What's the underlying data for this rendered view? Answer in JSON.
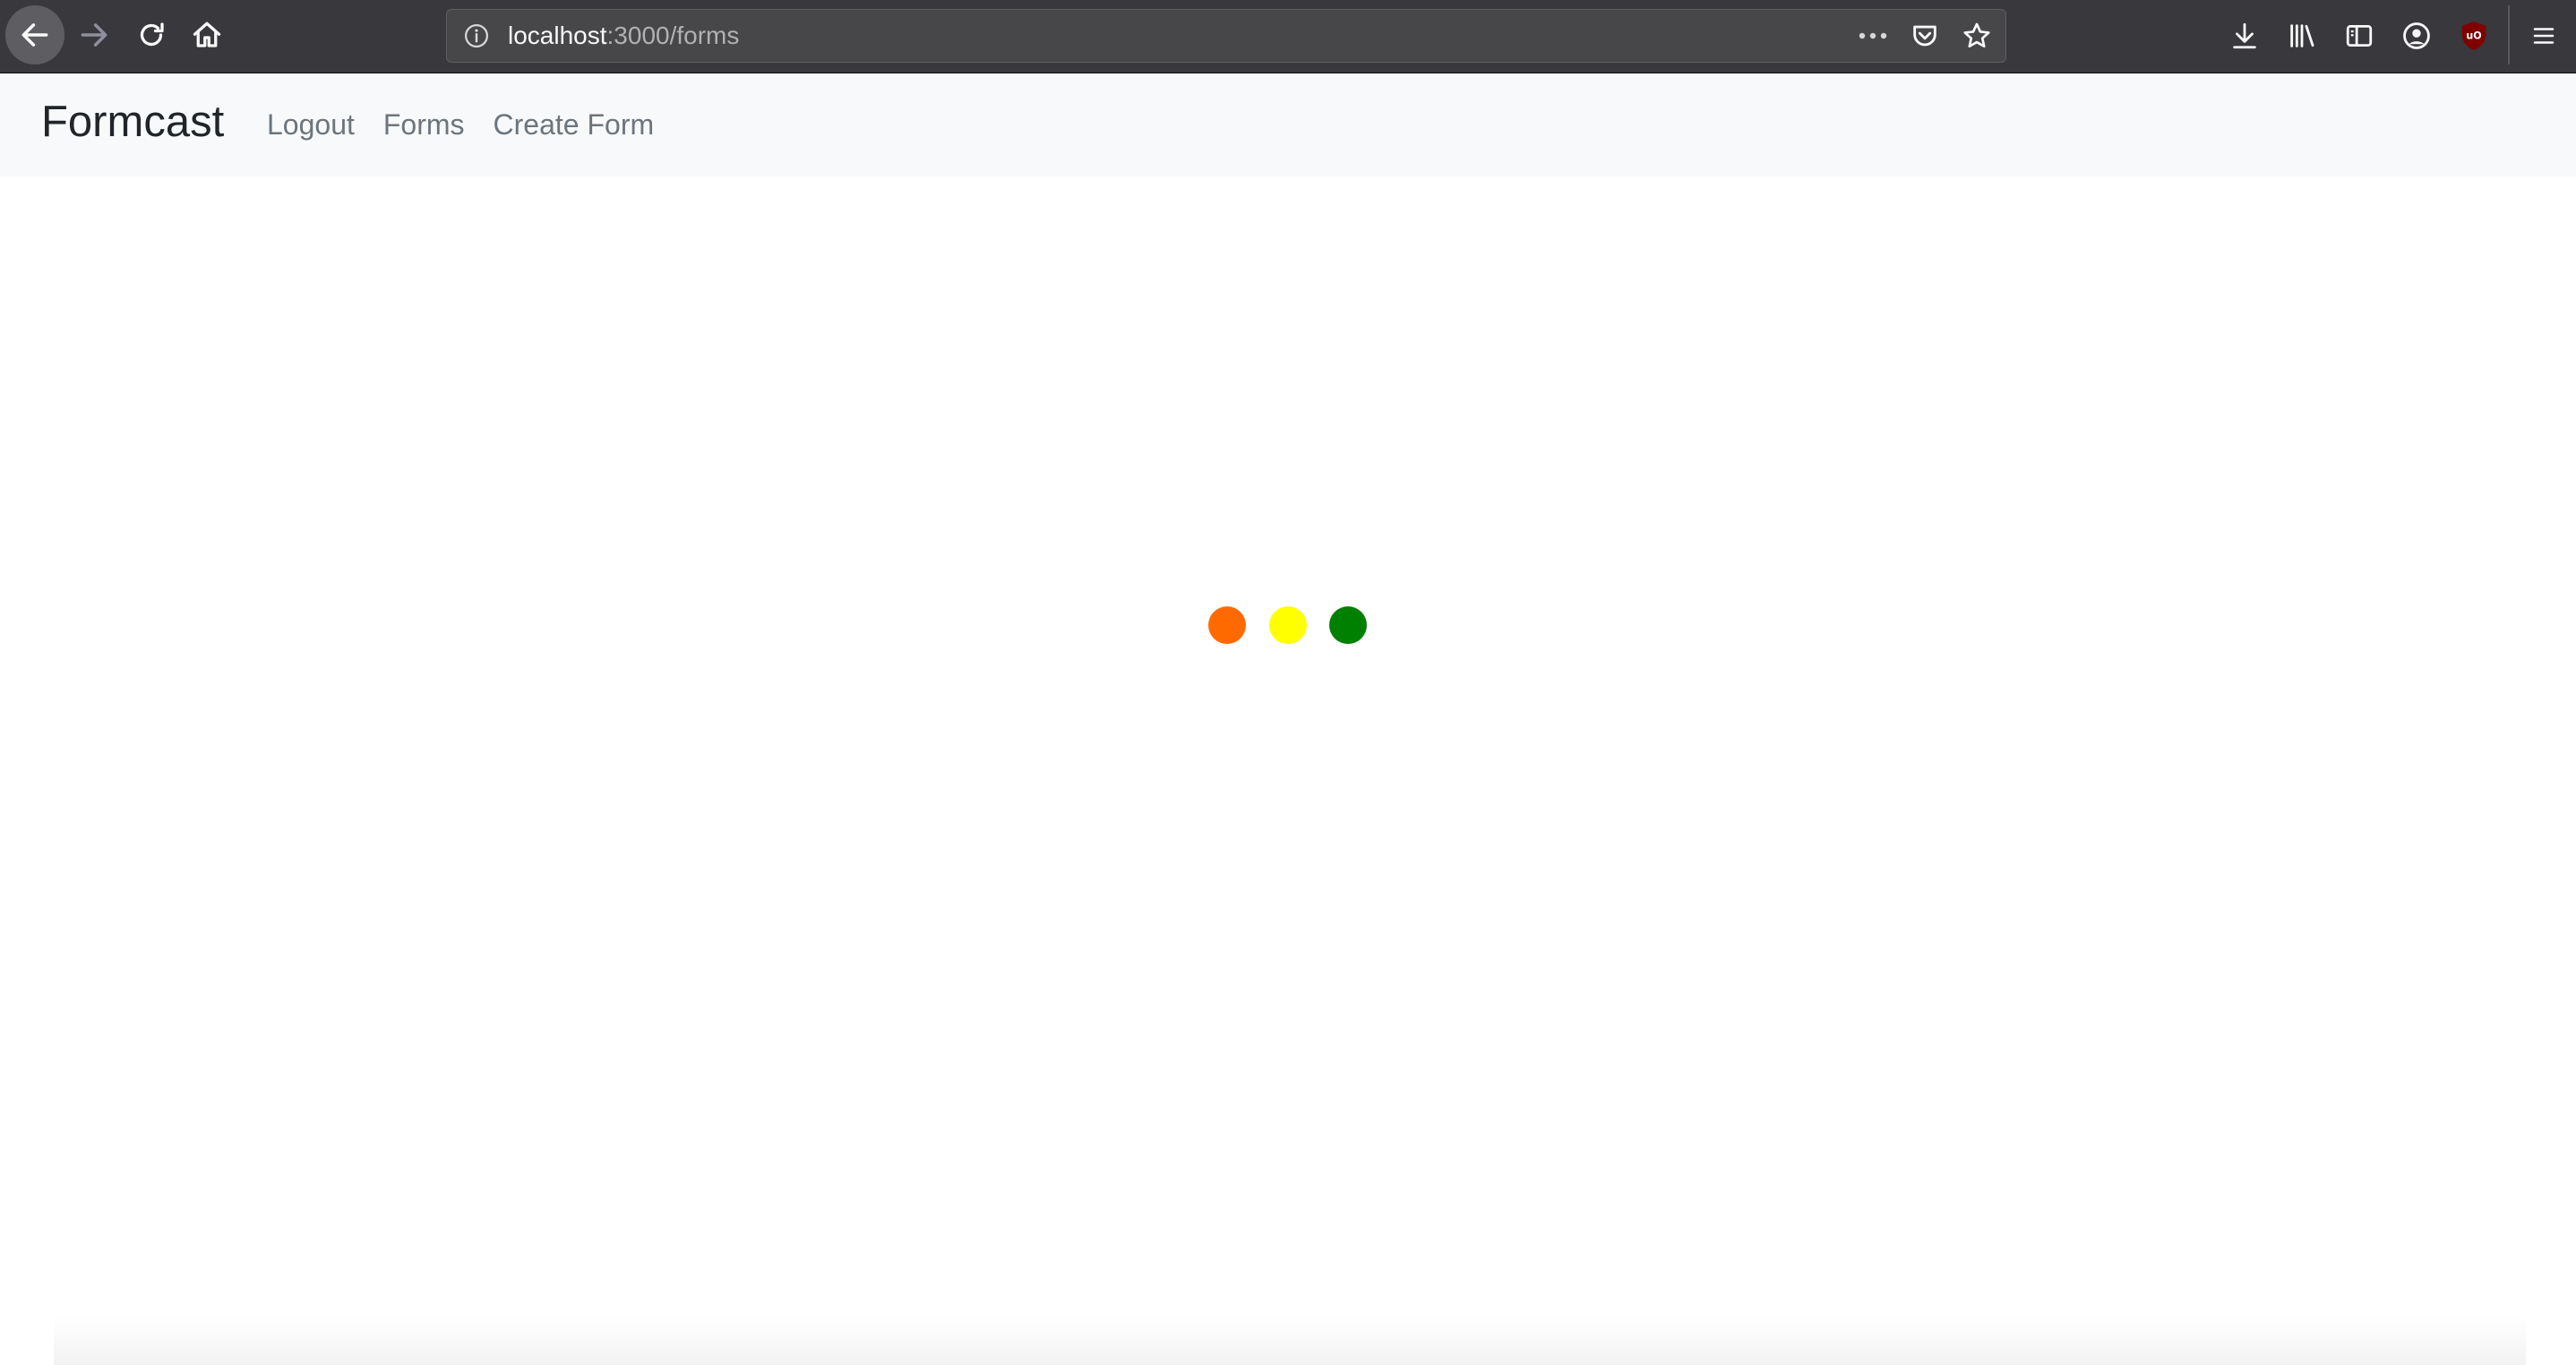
{
  "browser": {
    "url_host": "localhost",
    "url_path": ":3000/forms",
    "icons": {
      "back": "back-arrow-icon",
      "forward": "forward-arrow-icon",
      "reload": "reload-icon",
      "home": "home-icon",
      "info": "info-icon",
      "page_actions": "more-dots-icon",
      "pocket": "pocket-icon",
      "bookmark": "star-icon",
      "downloads": "download-icon",
      "library": "library-icon",
      "sidebar": "sidebar-icon",
      "account": "account-icon",
      "ublock": "ublock-shield-icon",
      "menu": "hamburger-menu-icon"
    },
    "colors": {
      "toolbar_bg": "#38383d",
      "urlbar_bg": "#474749",
      "icon": "#f9f9fa",
      "ublock_red": "#800000"
    }
  },
  "navbar": {
    "brand": "Formcast",
    "links": [
      {
        "label": "Logout"
      },
      {
        "label": "Forms"
      },
      {
        "label": "Create Form"
      }
    ],
    "colors": {
      "bg": "#f8f9fa",
      "brand": "#212529",
      "link": "#6c757d"
    }
  },
  "loader": {
    "dots": [
      {
        "color": "#ff6a00"
      },
      {
        "color": "#ffff00"
      },
      {
        "color": "#008000"
      }
    ]
  }
}
